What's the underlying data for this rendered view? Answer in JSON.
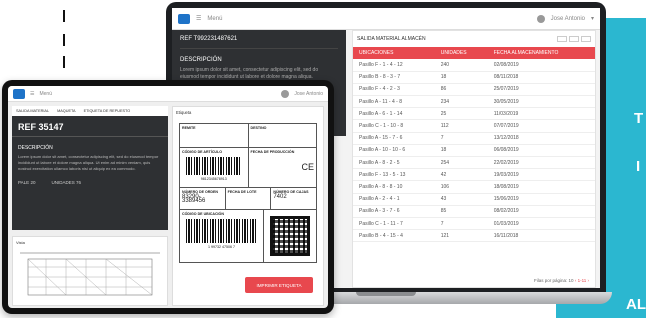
{
  "promo": {
    "letters": [
      "T",
      "I",
      "AL"
    ]
  },
  "laptop": {
    "menu_label": "Menú",
    "user_label": "Jose Antonio",
    "left_header": "REF T992231487621",
    "left_subheader": "DESCRIPCIÓN",
    "left_desc": "Lorem ipsum dolor sit amet, consectetur adipiscing elit, sed do eiusmod tempor incididunt ut labore et dolore magna aliqua.",
    "right_title": "SALIDA MATERIAL ALMACÉN",
    "columns": [
      "UBICACIONES",
      "UNIDADES",
      "FECHA ALMACENAMIENTO"
    ],
    "rows": [
      [
        "Pasillo F - 1 - 4 - 12",
        "240",
        "02/08/2019"
      ],
      [
        "Pasillo B - 8 - 3 - 7",
        "18",
        "08/11/2018"
      ],
      [
        "Pasillo F - 4 - 2 - 3",
        "86",
        "25/07/2019"
      ],
      [
        "Pasillo A - 11 - 4 - 8",
        "234",
        "30/05/2019"
      ],
      [
        "Pasillo A - 6 - 1 - 14",
        "25",
        "11/03/2019"
      ],
      [
        "Pasillo C - 1 - 10 - 8",
        "112",
        "07/07/2019"
      ],
      [
        "Pasillo A - 15 - 7 - 6",
        "7",
        "13/12/2018"
      ],
      [
        "Pasillo A - 10 - 10 - 6",
        "18",
        "06/08/2019"
      ],
      [
        "Pasillo A - 8 - 2 - 5",
        "254",
        "22/02/2019"
      ],
      [
        "Pasillo F - 13 - 5 - 13",
        "42",
        "19/03/2019"
      ],
      [
        "Pasillo A - 8 - 8 - 10",
        "106",
        "18/08/2019"
      ],
      [
        "Pasillo A - 2 - 4 - 1",
        "43",
        "15/06/2019"
      ],
      [
        "Pasillo A - 3 - 7 - 6",
        "85",
        "08/02/2019"
      ],
      [
        "Pasillo C - 1 - 11 - 7",
        "7",
        "01/03/2019"
      ],
      [
        "Pasillo B - 4 - 15 - 4",
        "121",
        "16/11/2018"
      ]
    ],
    "footer_rows_label": "Filas por página:",
    "footer_rows_value": "10",
    "footer_pager": "‹ 1-11 ›"
  },
  "tablet": {
    "menu_label": "Menú",
    "user_label": "Jose Antonio",
    "subnav": [
      "SALIDA MATERIAL",
      "MAQUETA",
      "ETIQUETA DE REPUESTO"
    ],
    "ref": "REF 35147",
    "desc_header": "DESCRIPCIÓN",
    "desc": "Lorem ipsum dolor sit amet, consectetur adipiscing elit, sed do eiusmod tempor incididunt ut labore et dolore magna aliqua. Ut enim ad minim veniam, quis nostrud exercitation ullamco laboris nisi ut aliquip ex ea commodo.",
    "pale_label": "PALE",
    "pale_value": "20",
    "units_label": "UNIDADES",
    "units_value": "76",
    "drawing_label": "Vista",
    "label_area_title": "Etiqueta",
    "lbl_sender": "REMITE",
    "lbl_dest": "DESTINO",
    "lbl_article": "CÓDIGO DE ARTÍCULO",
    "lbl_barcode_num": "9812345678913",
    "lbl_prod_date": "FECHA DE PRODUCCIÓN",
    "lbl_ce": "CE",
    "lbl_num_order": "NÚMERO DE ORDEN",
    "lbl_batch": "FECHA DE LOTE",
    "lbl_num_boxes": "NÚMERO DE CAJAS",
    "lbl_order_value": "83290-3389456",
    "lbl_boxes_value": "7402",
    "lbl_location": "CÓDIGO DE UBICACIÓN",
    "lbl_loc_barcode": "1 99732 47506 7",
    "print_button": "IMPRIMIR ETIQUETA"
  }
}
